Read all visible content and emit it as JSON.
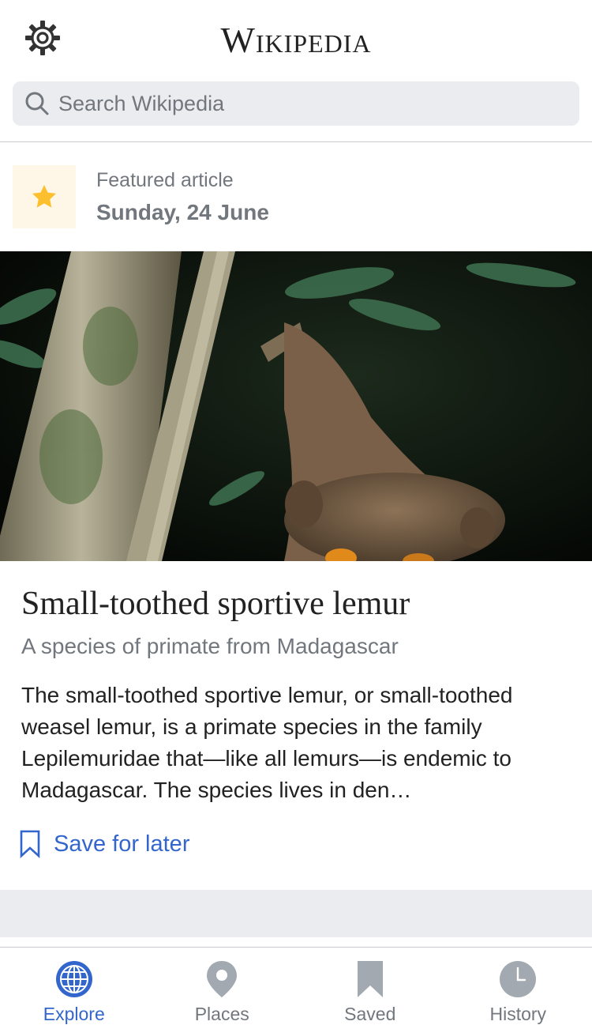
{
  "header": {
    "wordmark": "Wikipedia",
    "settings_icon": "gear-icon"
  },
  "search": {
    "placeholder": "Search Wikipedia",
    "icon": "search-icon"
  },
  "feature": {
    "label": "Featured article",
    "date": "Sunday, 24 June",
    "icon": "star-icon",
    "star_color": "#fcc02e",
    "star_bg": "#fef6e7"
  },
  "article": {
    "image_alt": "Photo of a small-toothed sportive lemur on a tree branch at night",
    "title": "Small-toothed sportive lemur",
    "description": "A species of primate from Madagascar",
    "extract": "The small-toothed sportive lemur, or small-toothed weasel lemur, is a primate species in the family Lepilemuridae that—like all lemurs—is endemic to Madagascar. The species lives in den…",
    "save_label": "Save for later",
    "save_icon": "bookmark-outline-icon"
  },
  "tabs": [
    {
      "label": "Explore",
      "icon": "globe-icon",
      "active": true
    },
    {
      "label": "Places",
      "icon": "map-pin-icon",
      "active": false
    },
    {
      "label": "Saved",
      "icon": "bookmark-icon",
      "active": false
    },
    {
      "label": "History",
      "icon": "clock-icon",
      "active": false
    }
  ],
  "colors": {
    "accent": "#3366cc",
    "secondary_text": "#72777d",
    "search_bg": "#eaecf0"
  }
}
